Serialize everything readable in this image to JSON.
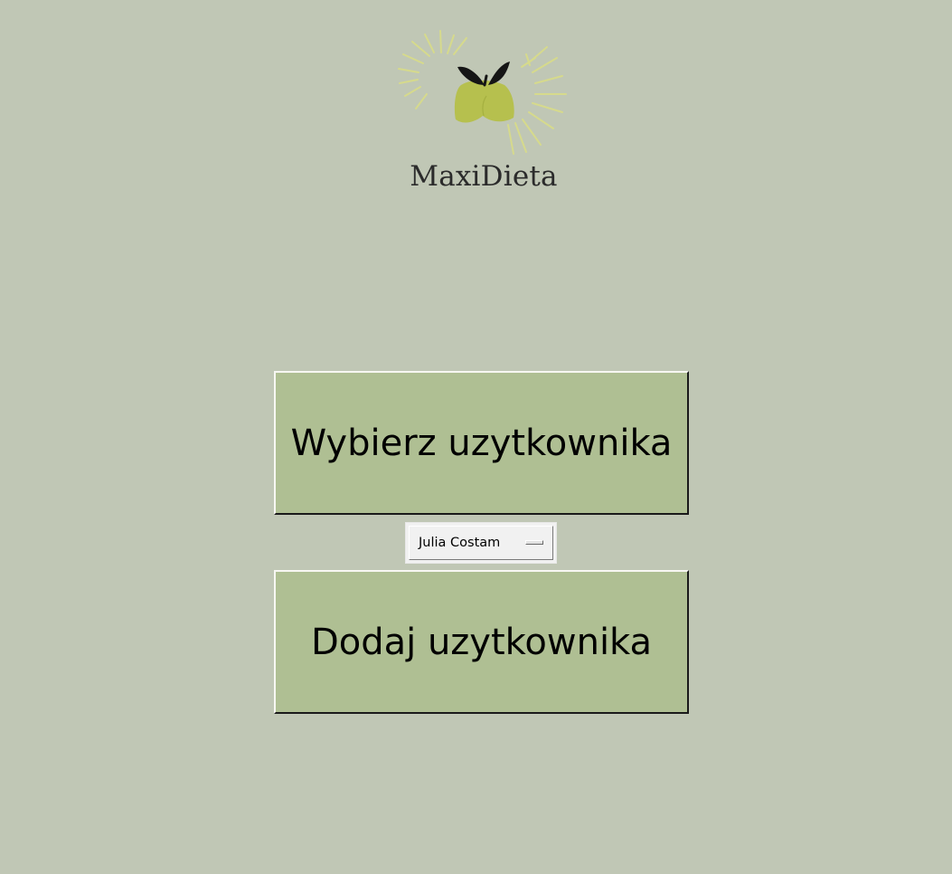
{
  "app": {
    "logo_text": "MaxiDieta",
    "logo_icon": "lemon-leaf-burst-icon"
  },
  "buttons": {
    "select_user_label": "Wybierz uzytkownika",
    "add_user_label": "Dodaj uzytkownika"
  },
  "user_dropdown": {
    "selected_value": "Julia Costam"
  },
  "colors": {
    "background": "#c0c7b5",
    "button_fill": "#afbf93",
    "logo_fruit": "#b6c04e",
    "logo_rays": "#d8db8a"
  }
}
